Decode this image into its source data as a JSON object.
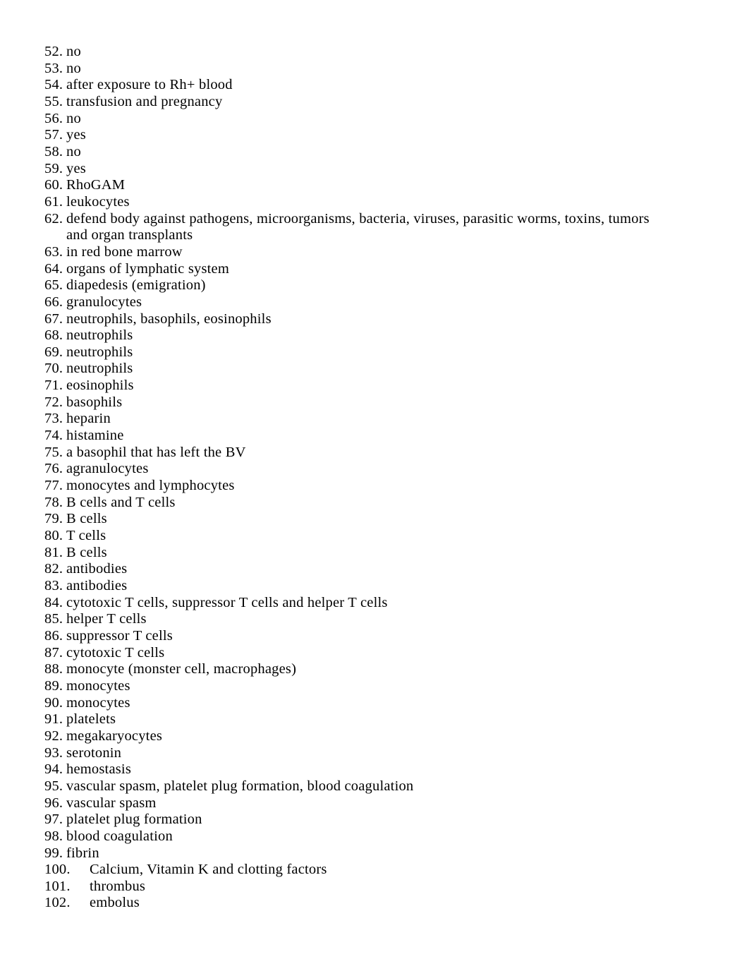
{
  "document": {
    "type": "answer-key-list",
    "page_background": "#ffffff",
    "text_color": "#000000",
    "items": [
      {
        "number": "52.",
        "text": "no",
        "indent": "narrow"
      },
      {
        "number": "53.",
        "text": "no",
        "indent": "narrow"
      },
      {
        "number": "54.",
        "text": "after exposure to Rh+ blood",
        "indent": "narrow"
      },
      {
        "number": "55.",
        "text": "transfusion and pregnancy",
        "indent": "narrow"
      },
      {
        "number": "56.",
        "text": "no",
        "indent": "narrow"
      },
      {
        "number": "57.",
        "text": "yes",
        "indent": "narrow"
      },
      {
        "number": "58.",
        "text": "no",
        "indent": "narrow"
      },
      {
        "number": "59.",
        "text": "yes",
        "indent": "narrow"
      },
      {
        "number": "60.",
        "text": "RhoGAM",
        "indent": "narrow"
      },
      {
        "number": "61.",
        "text": "leukocytes",
        "indent": "narrow"
      },
      {
        "number": "62.",
        "text": "defend body against pathogens, microorganisms, bacteria, viruses, parasitic worms, toxins, tumors and organ transplants",
        "indent": "narrow"
      },
      {
        "number": "63.",
        "text": "in red bone marrow",
        "indent": "narrow"
      },
      {
        "number": "64.",
        "text": "organs of lymphatic system",
        "indent": "narrow"
      },
      {
        "number": "65.",
        "text": "diapedesis (emigration)",
        "indent": "narrow"
      },
      {
        "number": "66.",
        "text": "granulocytes",
        "indent": "narrow"
      },
      {
        "number": "67.",
        "text": "neutrophils, basophils, eosinophils",
        "indent": "narrow"
      },
      {
        "number": "68.",
        "text": "neutrophils",
        "indent": "narrow"
      },
      {
        "number": "69.",
        "text": "neutrophils",
        "indent": "narrow"
      },
      {
        "number": "70.",
        "text": "neutrophils",
        "indent": "narrow"
      },
      {
        "number": "71.",
        "text": "eosinophils",
        "indent": "narrow"
      },
      {
        "number": "72.",
        "text": "basophils",
        "indent": "narrow"
      },
      {
        "number": "73.",
        "text": "heparin",
        "indent": "narrow"
      },
      {
        "number": "74.",
        "text": "histamine",
        "indent": "narrow"
      },
      {
        "number": "75.",
        "text": "a basophil that has left the BV",
        "indent": "narrow"
      },
      {
        "number": "76.",
        "text": "agranulocytes",
        "indent": "narrow"
      },
      {
        "number": "77.",
        "text": "monocytes and lymphocytes",
        "indent": "narrow"
      },
      {
        "number": "78.",
        "text": "B cells and T cells",
        "indent": "narrow"
      },
      {
        "number": "79.",
        "text": "B cells",
        "indent": "narrow"
      },
      {
        "number": "80.",
        "text": "T cells",
        "indent": "narrow"
      },
      {
        "number": "81.",
        "text": "B cells",
        "indent": "narrow"
      },
      {
        "number": "82.",
        "text": "antibodies",
        "indent": "narrow"
      },
      {
        "number": "83.",
        "text": "antibodies",
        "indent": "narrow"
      },
      {
        "number": "84.",
        "text": "cytotoxic T cells, suppressor T cells and helper T cells",
        "indent": "narrow"
      },
      {
        "number": "85.",
        "text": "helper T cells",
        "indent": "narrow"
      },
      {
        "number": "86.",
        "text": "suppressor T cells",
        "indent": "narrow"
      },
      {
        "number": "87.",
        "text": "cytotoxic T cells",
        "indent": "narrow"
      },
      {
        "number": "88.",
        "text": "monocyte (monster cell, macrophages)",
        "indent": "narrow"
      },
      {
        "number": "89.",
        "text": "monocytes",
        "indent": "narrow"
      },
      {
        "number": "90.",
        "text": "monocytes",
        "indent": "narrow"
      },
      {
        "number": "91.",
        "text": "platelets",
        "indent": "narrow"
      },
      {
        "number": "92.",
        "text": "megakaryocytes",
        "indent": "narrow"
      },
      {
        "number": "93.",
        "text": "serotonin",
        "indent": "narrow"
      },
      {
        "number": "94.",
        "text": "hemostasis",
        "indent": "narrow"
      },
      {
        "number": "95.",
        "text": "vascular spasm, platelet plug formation, blood coagulation",
        "indent": "narrow"
      },
      {
        "number": "96.",
        "text": "vascular spasm",
        "indent": "narrow"
      },
      {
        "number": "97.",
        "text": "platelet plug formation",
        "indent": "narrow"
      },
      {
        "number": "98.",
        "text": "blood coagulation",
        "indent": "narrow"
      },
      {
        "number": "99.",
        "text": "fibrin",
        "indent": "narrow"
      },
      {
        "number": "100.",
        "text": "Calcium, Vitamin K and clotting factors",
        "indent": "wide"
      },
      {
        "number": "101.",
        "text": "thrombus",
        "indent": "wide"
      },
      {
        "number": "102.",
        "text": "embolus",
        "indent": "wide"
      }
    ]
  }
}
